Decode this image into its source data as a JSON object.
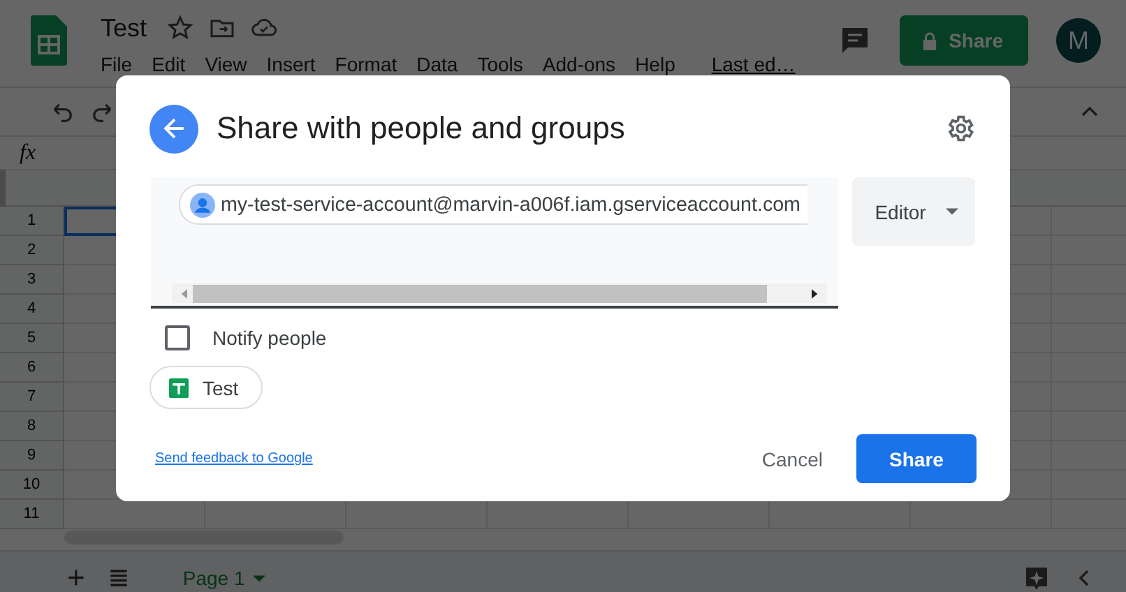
{
  "app": {
    "doc_title": "Test",
    "menu": [
      "File",
      "Edit",
      "View",
      "Insert",
      "Format",
      "Data",
      "Tools",
      "Add-ons",
      "Help"
    ],
    "last_edit": "Last ed…",
    "share_button": "Share",
    "avatar": "M",
    "formula_label": "fx",
    "rows": [
      "1",
      "2",
      "3",
      "4",
      "5",
      "6",
      "7",
      "8",
      "9",
      "10",
      "11"
    ],
    "add_sheet": "+",
    "sheet_tab": "Page 1"
  },
  "dialog": {
    "title": "Share with people and groups",
    "recipient": "my-test-service-account@marvin-a006f.iam.gserviceaccount.com",
    "role": "Editor",
    "notify": {
      "label": "Notify people",
      "checked": false
    },
    "file_chip": "Test",
    "feedback_link": "Send feedback to Google",
    "cancel_button": "Cancel",
    "share_button": "Share"
  }
}
